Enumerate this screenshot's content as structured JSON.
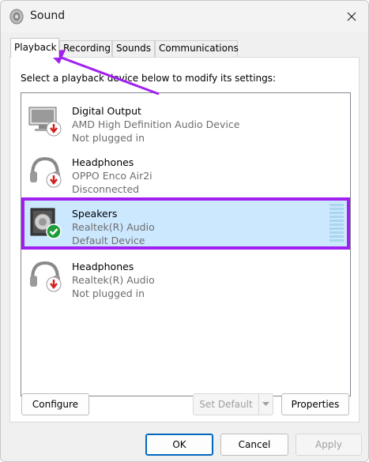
{
  "window": {
    "title": "Sound",
    "close_icon": "close-icon",
    "app_icon": "speaker-icon"
  },
  "tabs": [
    {
      "label": "Playback",
      "active": true
    },
    {
      "label": "Recording",
      "active": false
    },
    {
      "label": "Sounds",
      "active": false
    },
    {
      "label": "Communications",
      "active": false
    }
  ],
  "panel": {
    "instruction": "Select a playback device below to modify its settings:"
  },
  "devices": [
    {
      "name": "Digital Output",
      "driver": "AMD High Definition Audio Device",
      "status": "Not plugged in",
      "icon": "monitor-icon",
      "badge": "unplugged-badge-icon"
    },
    {
      "name": "Headphones",
      "driver": "OPPO Enco Air2i",
      "status": "Disconnected",
      "icon": "headphones-icon",
      "badge": "unplugged-badge-icon"
    },
    {
      "name": "Speakers",
      "driver": "Realtek(R) Audio",
      "status": "Default Device",
      "icon": "speaker-icon",
      "badge": "default-check-badge-icon",
      "selected": true
    },
    {
      "name": "Headphones",
      "driver": "Realtek(R) Audio",
      "status": "Not plugged in",
      "icon": "headphones-icon",
      "badge": "unplugged-badge-icon"
    }
  ],
  "buttons": {
    "configure": "Configure",
    "set_default": "Set Default",
    "properties": "Properties",
    "ok": "OK",
    "cancel": "Cancel",
    "apply": "Apply"
  },
  "colors": {
    "selection_bg": "#cce8ff",
    "highlight_outline": "#a020f0",
    "check_green": "#1f9d3a",
    "unplugged_red": "#d42020"
  }
}
